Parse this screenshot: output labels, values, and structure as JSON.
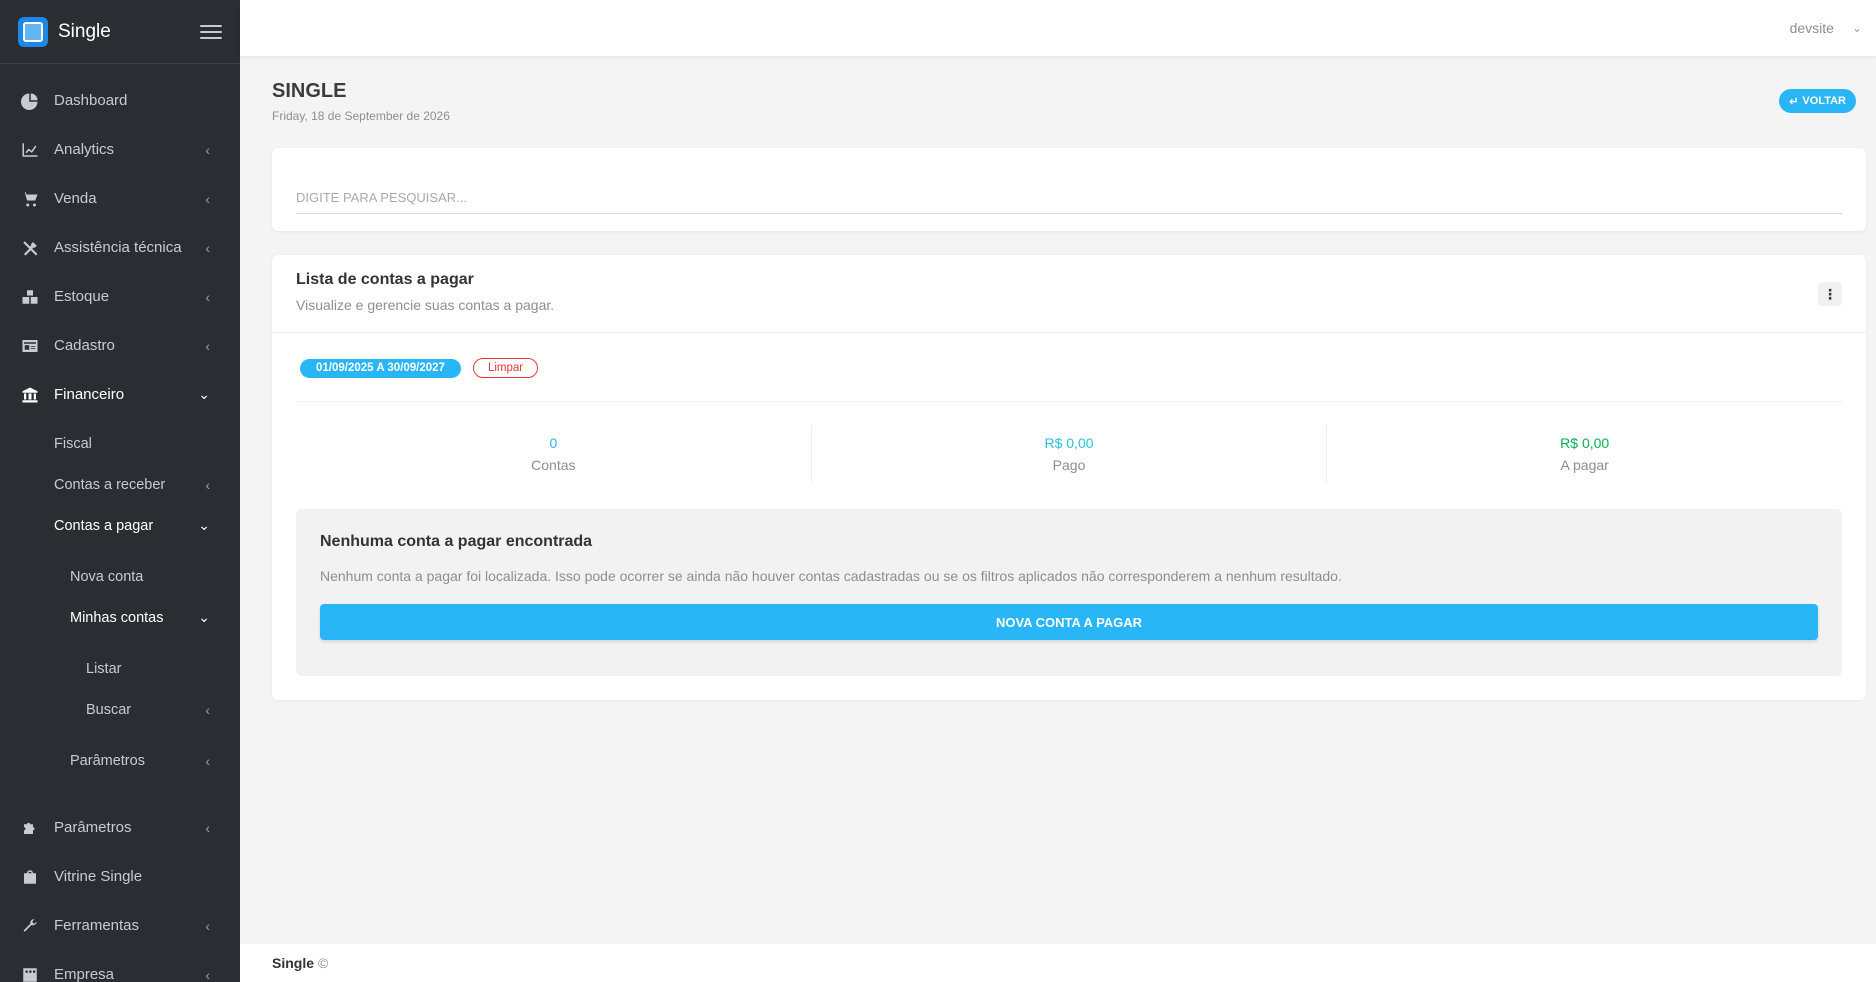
{
  "brand": {
    "name": "Single"
  },
  "topbar": {
    "user": "devsite"
  },
  "sidebar": {
    "items": [
      {
        "label": "Dashboard"
      },
      {
        "label": "Analytics"
      },
      {
        "label": "Venda"
      },
      {
        "label": "Assistência técnica"
      },
      {
        "label": "Estoque"
      },
      {
        "label": "Cadastro"
      },
      {
        "label": "Financeiro"
      }
    ],
    "financeiro": {
      "fiscal": "Fiscal",
      "contas_receber": "Contas a receber",
      "contas_pagar": "Contas a pagar",
      "nova_conta": "Nova conta",
      "minhas_contas": "Minhas contas",
      "listar": "Listar",
      "buscar": "Buscar",
      "parametros": "Parâmetros"
    },
    "bottom_items": [
      {
        "label": "Parâmetros"
      },
      {
        "label": "Vitrine Single"
      },
      {
        "label": "Ferramentas"
      },
      {
        "label": "Empresa"
      }
    ]
  },
  "page": {
    "title": "SINGLE",
    "date": "Friday, 18 de September de 2026",
    "back_label": "VOLTAR"
  },
  "search": {
    "placeholder": "DIGITE PARA PESQUISAR..."
  },
  "list": {
    "title": "Lista de contas a pagar",
    "subtitle": "Visualize e gerencie suas contas a pagar.",
    "date_range": "01/09/2025 A 30/09/2027",
    "clear_label": "Limpar",
    "stats": [
      {
        "value": "0",
        "label": "Contas",
        "color": "#29b6f6"
      },
      {
        "value": "R$ 0,00",
        "label": "Pago",
        "color": "#26c6da"
      },
      {
        "value": "R$ 0,00",
        "label": "A pagar",
        "color": "#00b050"
      }
    ],
    "empty": {
      "title": "Nenhuma conta a pagar encontrada",
      "text": "Nenhum conta a pagar foi localizada. Isso pode ocorrer se ainda não houver contas cadastradas ou se os filtros aplicados não corresponderem a nenhum resultado.",
      "button": "NOVA CONTA A PAGAR"
    }
  },
  "footer": {
    "brand": "Single",
    "copy": "©"
  }
}
